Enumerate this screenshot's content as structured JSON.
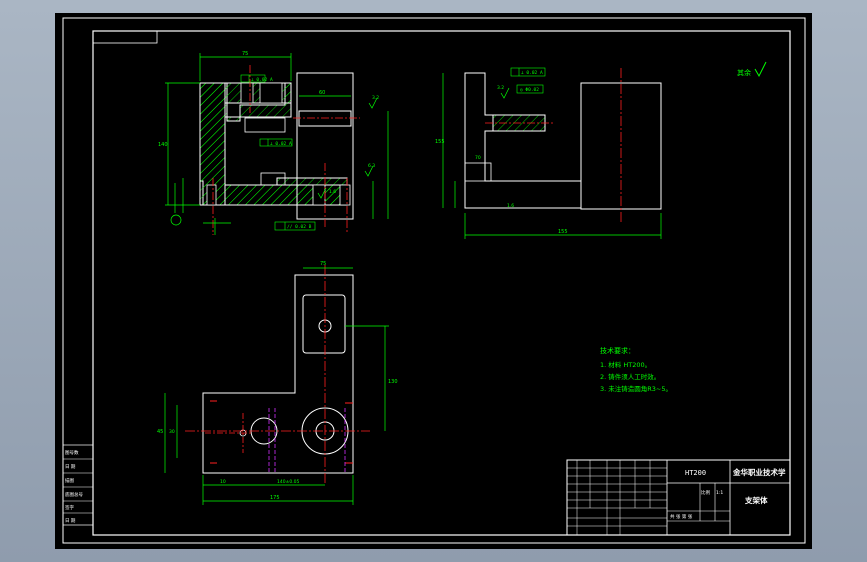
{
  "drawing": {
    "title_block": {
      "material": "HT200",
      "institution": "金华职业技术学",
      "part_name": "支架体",
      "scale_label": "比例",
      "scale_value": "1:1",
      "sheet_marks": "共 张 第 张"
    },
    "tech_requirements": {
      "heading": "技术要求：",
      "items": [
        "1. 材料 HT200。",
        "2. 铸件须人工时效。",
        "3. 未注铸造圆角R3~5。"
      ]
    },
    "roughness_note": "其余",
    "dimensions": {
      "front_top_width": "75",
      "front_height": "140",
      "slot_width": "60",
      "top_view_width": "75",
      "top_view_depth": "130",
      "top_view_bottom": "175",
      "side_total": "155",
      "side_height": "155",
      "hole_spacing": "140±0.05",
      "side_small": "70",
      "side_left": "45",
      "bottom_small": "10",
      "left_vertical": "45",
      "left_inner": "30"
    },
    "tolerance_frames": [
      "⊥ 0.02 A",
      "// 0.02 B",
      "⊥ 0.02 A",
      "⊥ 0.02 A",
      "◎ Φ0.02"
    ],
    "roughness": [
      "3.2",
      "6.3",
      "1.6",
      "3.2",
      "1.6"
    ],
    "left_strip": [
      "图号数",
      "日 期",
      "描图",
      "底图总号",
      "签字",
      "日 期"
    ]
  }
}
